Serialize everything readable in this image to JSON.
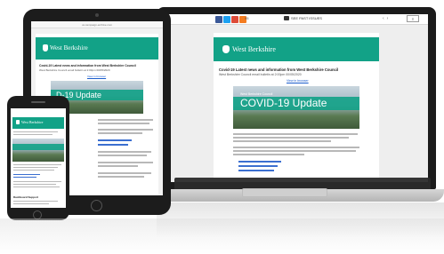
{
  "brand": {
    "accent": "#12a287",
    "logo_text": "West Berkshire"
  },
  "laptop": {
    "share_buttons": [
      {
        "name": "facebook-icon",
        "color": "#3b5998"
      },
      {
        "name": "twitter-icon",
        "color": "#1da1f2"
      },
      {
        "name": "google-plus-icon",
        "color": "#dd4b39"
      },
      {
        "name": "plus-icon",
        "color": "#f47c20"
      }
    ],
    "share_count": "95",
    "toolbar_text": "SEE PAST ISSUES",
    "translate_label": "Translate",
    "email": {
      "title": "Covid-19 Latest news and information from West Berkshire Council",
      "subtitle": "West Berkshire Council email bulletin at 2:00pm 00/05/2020",
      "browser_link": "View in browser",
      "hero_kicker": "West Berkshire Council",
      "hero_title": "COVID-19 Update"
    }
  },
  "tablet": {
    "url": "us.campaign-archive.com",
    "email": {
      "title": "Covid-19 Latest news and information from West Berkshire Council",
      "subtitle": "West Berkshire Council email bulletin at 2:00pm 00/05/2020",
      "browser_link": "View in browser",
      "hero_title": "D-19 Update"
    }
  },
  "phone": {
    "section_title": "Dashboard Support"
  }
}
